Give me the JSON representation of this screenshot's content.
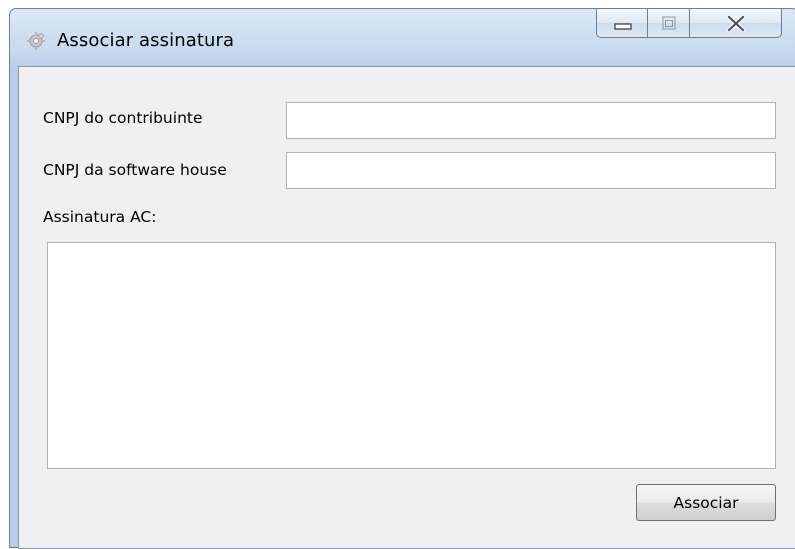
{
  "window": {
    "title": "Associar assinatura",
    "controls": {
      "minimize": "minimize-icon",
      "maximize": "maximize-icon",
      "close": "close-icon"
    },
    "app_icon": "gear-icon"
  },
  "form": {
    "cnpj_contribuinte_label": "CNPJ do contribuinte",
    "cnpj_contribuinte_value": "",
    "cnpj_software_house_label": "CNPJ da software house",
    "cnpj_software_house_value": "",
    "assinatura_label": "Assinatura AC:",
    "assinatura_value": "",
    "submit_label": "Associar"
  }
}
